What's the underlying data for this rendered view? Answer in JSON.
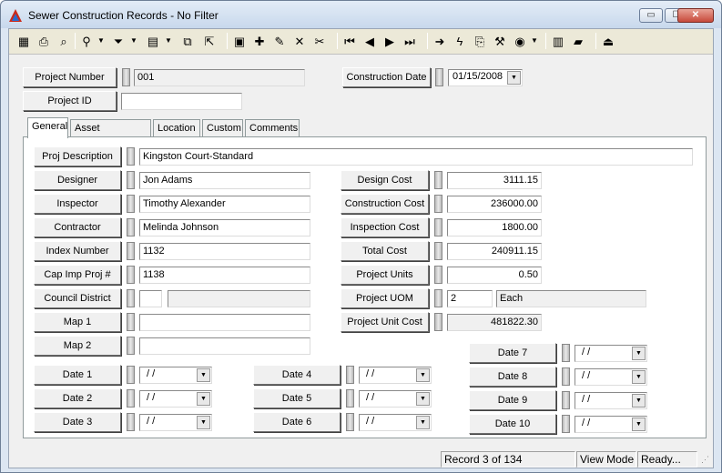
{
  "window": {
    "title": "Sewer Construction Records - No Filter",
    "controls": {
      "minimize": "▭",
      "maximize": "☐",
      "close": "✕"
    }
  },
  "toolbar": {
    "icons": [
      {
        "name": "grid-icon",
        "glyph": "▦"
      },
      {
        "name": "print-icon",
        "glyph": "⎙"
      },
      {
        "name": "print-preview-icon",
        "glyph": "⌕"
      },
      {
        "name": "binoculars-icon",
        "glyph": "⚲"
      },
      {
        "name": "filter-icon",
        "glyph": "⏷"
      },
      {
        "name": "report-icon",
        "glyph": "▤"
      },
      {
        "name": "copy-doc-icon",
        "glyph": "⧉"
      },
      {
        "name": "export-icon",
        "glyph": "⇱"
      },
      {
        "name": "save-icon",
        "glyph": "▣"
      },
      {
        "name": "new-record-icon",
        "glyph": "✚"
      },
      {
        "name": "edit-pencil-icon",
        "glyph": "✎"
      },
      {
        "name": "delete-icon",
        "glyph": "✕"
      },
      {
        "name": "cut-icon",
        "glyph": "✂"
      },
      {
        "name": "first-record-icon",
        "glyph": "⏮"
      },
      {
        "name": "prev-record-icon",
        "glyph": "◀"
      },
      {
        "name": "next-record-icon",
        "glyph": "▶"
      },
      {
        "name": "last-record-icon",
        "glyph": "⏭"
      },
      {
        "name": "goto-arrow-icon",
        "glyph": "➜"
      },
      {
        "name": "lightning-icon",
        "glyph": "ϟ"
      },
      {
        "name": "attach-icon",
        "glyph": "⎘"
      },
      {
        "name": "tool-icon",
        "glyph": "⚒"
      },
      {
        "name": "globe-icon",
        "glyph": "◉"
      },
      {
        "name": "calculator-icon",
        "glyph": "▥"
      },
      {
        "name": "book-icon",
        "glyph": "▰"
      },
      {
        "name": "exit-icon",
        "glyph": "⏏"
      }
    ]
  },
  "header": {
    "project_number_label": "Project Number",
    "project_number_value": "001",
    "project_id_label": "Project ID",
    "project_id_value": "",
    "construction_date_label": "Construction Date",
    "construction_date_value": "01/15/2008"
  },
  "tabs": [
    "General",
    "Asset Distribution",
    "Location",
    "Custom",
    "Comments"
  ],
  "general": {
    "proj_description_label": "Proj Description",
    "proj_description_value": "Kingston Court-Standard",
    "left": [
      {
        "label": "Designer",
        "value": "Jon Adams"
      },
      {
        "label": "Inspector",
        "value": "Timothy Alexander"
      },
      {
        "label": "Contractor",
        "value": "Melinda Johnson"
      },
      {
        "label": "Index Number",
        "value": "1132"
      },
      {
        "label": "Cap Imp Proj #",
        "value": "1138"
      }
    ],
    "council_district_label": "Council District",
    "council_district_code": "",
    "council_district_name": "",
    "map1_label": "Map 1",
    "map1_value": "",
    "map2_label": "Map 2",
    "map2_value": "",
    "right": [
      {
        "label": "Design Cost",
        "value": "3111.15"
      },
      {
        "label": "Construction Cost",
        "value": "236000.00"
      },
      {
        "label": "Inspection Cost",
        "value": "1800.00"
      },
      {
        "label": "Total Cost",
        "value": "240911.15"
      },
      {
        "label": "Project Units",
        "value": "0.50"
      }
    ],
    "project_uom_label": "Project UOM",
    "project_uom_code": "2",
    "project_uom_name": "Each",
    "project_unit_cost_label": "Project Unit Cost",
    "project_unit_cost_value": "481822.30",
    "dates": [
      {
        "label": "Date 1",
        "value": " / /"
      },
      {
        "label": "Date 2",
        "value": " / /"
      },
      {
        "label": "Date 3",
        "value": " / /"
      },
      {
        "label": "Date 4",
        "value": " / /"
      },
      {
        "label": "Date 5",
        "value": " / /"
      },
      {
        "label": "Date 6",
        "value": " / /"
      },
      {
        "label": "Date 7",
        "value": " / /"
      },
      {
        "label": "Date 8",
        "value": " / /"
      },
      {
        "label": "Date 9",
        "value": " / /"
      },
      {
        "label": "Date 10",
        "value": " / /"
      }
    ]
  },
  "status": {
    "record": "Record 3 of 134",
    "mode": "View Mode",
    "state": "Ready..."
  },
  "colors": {
    "title_bg": "#c8d8ec",
    "close_btn": "#c7493a"
  }
}
